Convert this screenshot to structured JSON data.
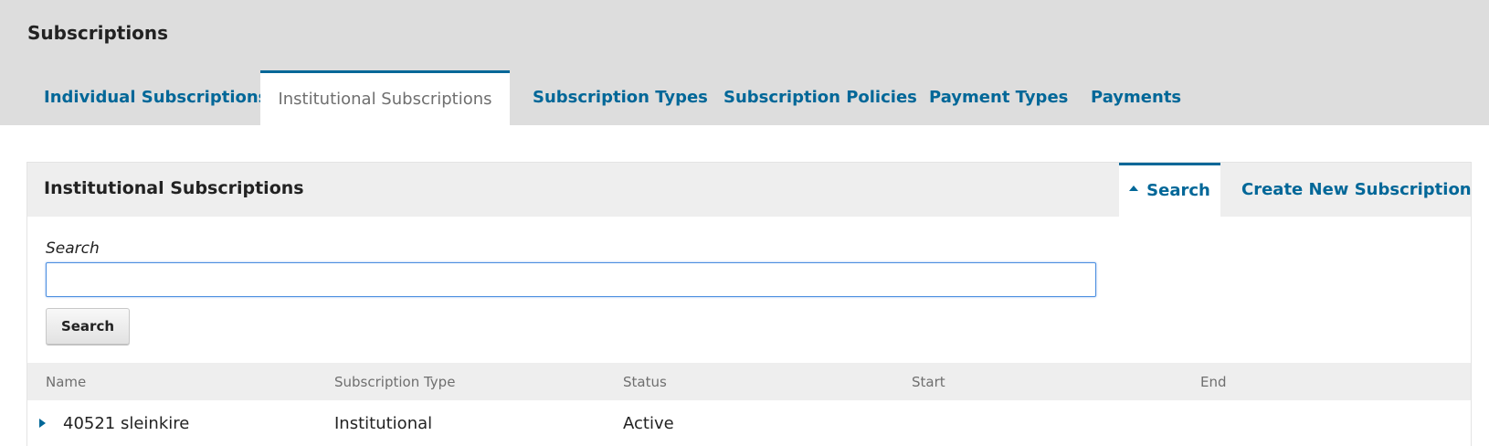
{
  "header": {
    "title": "Subscriptions",
    "tabs": [
      {
        "label": "Individual Subscriptions"
      },
      {
        "label": "Institutional Subscriptions"
      },
      {
        "label": "Subscription Types"
      },
      {
        "label": "Subscription Policies"
      },
      {
        "label": "Payment Types"
      },
      {
        "label": "Payments"
      }
    ],
    "active_tab": "Institutional Subscriptions"
  },
  "panel": {
    "title": "Institutional Subscriptions",
    "actions": {
      "search_label": "Search",
      "create_label": "Create New Subscription"
    },
    "search": {
      "label": "Search",
      "value": "",
      "button_label": "Search"
    },
    "table": {
      "columns": [
        "Name",
        "Subscription Type",
        "Status",
        "Start",
        "End"
      ],
      "rows": [
        {
          "name": "40521 sleinkire",
          "type": "Institutional",
          "status": "Active",
          "start": "",
          "end": ""
        }
      ]
    }
  },
  "colors": {
    "accent": "#006798",
    "header_bg": "#dddddd",
    "panel_header_bg": "#eeeeee",
    "muted_text": "#6f6f6f"
  },
  "icons": {
    "search_toggle": "caret-up-icon",
    "row_expand": "caret-right-icon"
  }
}
